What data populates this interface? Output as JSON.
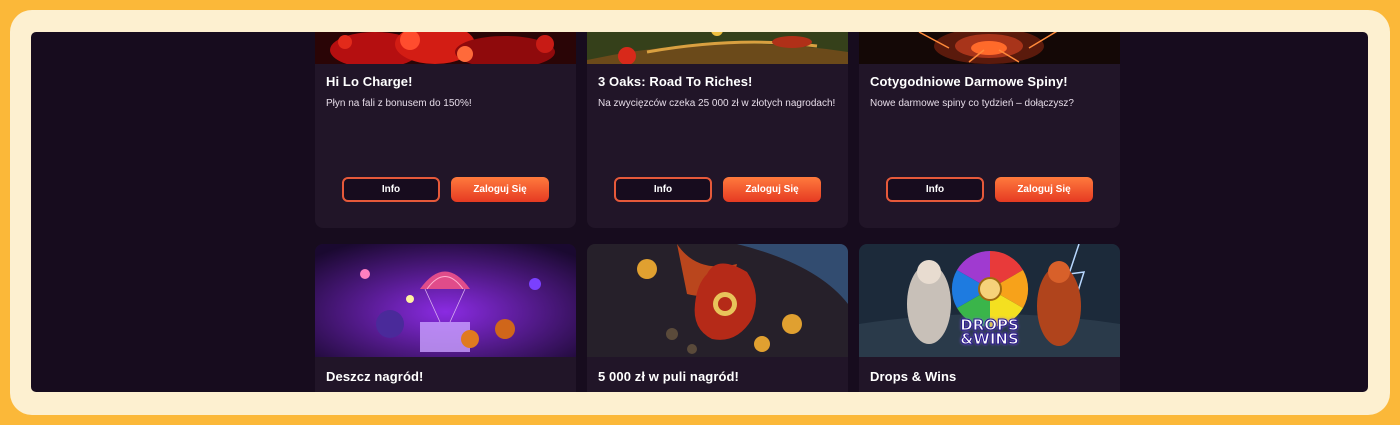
{
  "promotions_top": [
    {
      "title": "Hi Lo Charge!",
      "description": "Płyn na fali z bonusem do 150%!",
      "info_label": "Info",
      "login_label": "Zaloguj Się",
      "image_icon": "red-orbs-banner"
    },
    {
      "title": "3 Oaks: Road To Riches!",
      "description": "Na zwycięzców czeka 25 000 zł w złotych nagrodach!",
      "info_label": "Info",
      "login_label": "Zaloguj Się",
      "image_icon": "green-road-banner"
    },
    {
      "title": "Cotygodniowe Darmowe Spiny!",
      "description": "Nowe darmowe spiny co tydzień – dołączysz?",
      "info_label": "Info",
      "login_label": "Zaloguj Się",
      "image_icon": "fire-burst-banner"
    }
  ],
  "promotions_bottom": [
    {
      "title": "Deszcz nagród!",
      "image_icon": "parachute-halloween-banner"
    },
    {
      "title": "5 000 zł w puli nagród!",
      "image_icon": "flaming-vase-coins-banner"
    },
    {
      "title": "Drops & Wins",
      "image_icon": "drops-wins-wheel-banner",
      "logo_text": "DROPS &WINS"
    }
  ],
  "colors": {
    "page_bg": "#170c1e",
    "card_bg": "#211528",
    "accent": "#e6593a",
    "button_gradient_top": "#ff7a3d",
    "button_gradient_bottom": "#e63a22",
    "frame_outer": "#fbb839"
  }
}
